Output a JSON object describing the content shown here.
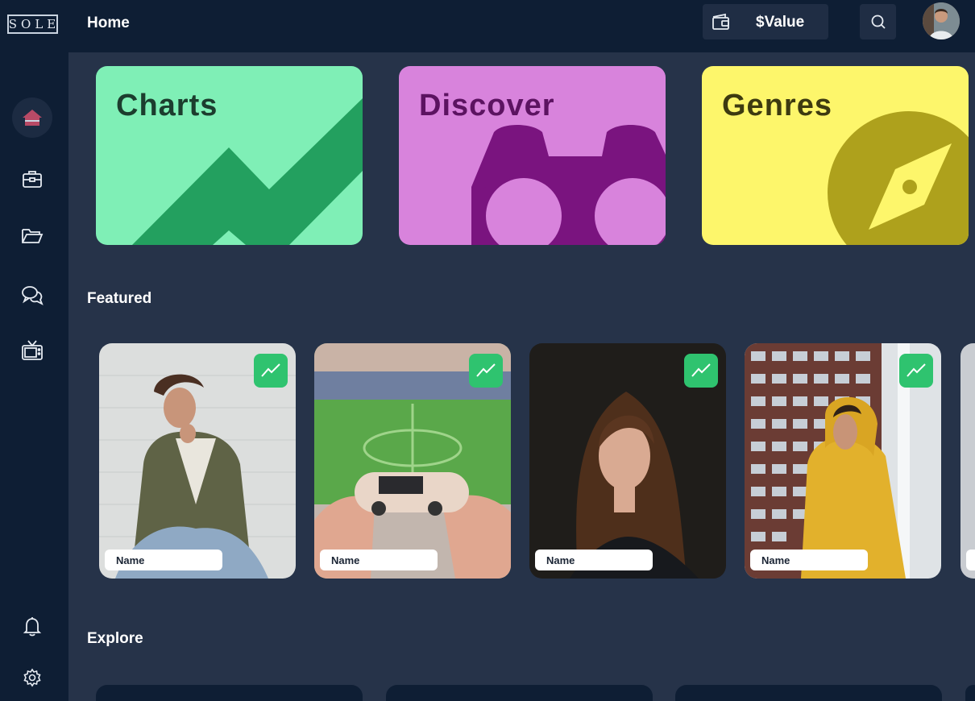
{
  "app": {
    "logo": "SOLE"
  },
  "topbar": {
    "title": "Home",
    "wallet_value": "$Value",
    "wallet_icon": "wallet-icon",
    "search_icon": "search-icon"
  },
  "sidebar": {
    "items": [
      {
        "icon": "home-icon",
        "active": true
      },
      {
        "icon": "briefcase-icon"
      },
      {
        "icon": "folder-icon"
      },
      {
        "icon": "chat-icon"
      },
      {
        "icon": "tv-icon"
      }
    ],
    "bottom": [
      {
        "icon": "bell-icon"
      },
      {
        "icon": "gear-icon"
      }
    ]
  },
  "categories": [
    {
      "title": "Charts",
      "bg": "#7fefb6",
      "accent": "#23a05f",
      "text": "#1c3d2e"
    },
    {
      "title": "Discover",
      "bg": "#d883dc",
      "accent": "#7a147f",
      "text": "#5c1361"
    },
    {
      "title": "Genres",
      "bg": "#fdf66b",
      "accent": "#aea11c",
      "text": "#3d3a10"
    }
  ],
  "featured": {
    "title": "Featured",
    "items": [
      {
        "name": "Name"
      },
      {
        "name": "Name"
      },
      {
        "name": "Name"
      },
      {
        "name": "Name"
      }
    ]
  },
  "explore": {
    "title": "Explore"
  },
  "colors": {
    "sidebar_bg": "#0e1e34",
    "main_bg": "#263349",
    "badge_green": "#2fc36f",
    "home_active": "#b84a66"
  }
}
